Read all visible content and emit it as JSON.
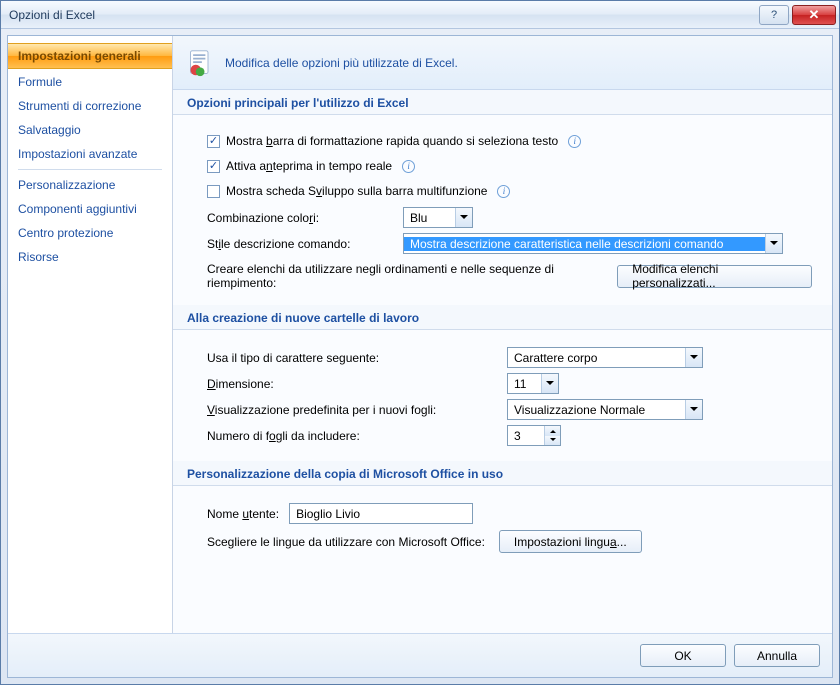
{
  "window": {
    "title": "Opzioni di Excel"
  },
  "sidebar": {
    "items": [
      "Impostazioni generali",
      "Formule",
      "Strumenti di correzione",
      "Salvataggio",
      "Impostazioni avanzate",
      "Personalizzazione",
      "Componenti aggiuntivi",
      "Centro protezione",
      "Risorse"
    ],
    "active_index": 0
  },
  "banner": {
    "text": "Modifica delle opzioni più utilizzate di Excel."
  },
  "section1": {
    "title": "Opzioni principali per l'utilizzo di Excel",
    "chk1_checked": true,
    "chk1_label_pre": "Mostra ",
    "chk1_label_u": "b",
    "chk1_label_post": "arra di formattazione rapida quando si seleziona testo",
    "chk2_checked": true,
    "chk2_label_pre": "Attiva a",
    "chk2_label_u": "n",
    "chk2_label_post": "teprima in tempo reale",
    "chk3_checked": false,
    "chk3_label_pre": "Mostra scheda S",
    "chk3_label_u": "v",
    "chk3_label_post": "iluppo sulla barra multifunzione",
    "color_label_pre": "Combinazione colo",
    "color_label_u": "r",
    "color_label_post": "i:",
    "color_value": "Blu",
    "tip_label_pre": "St",
    "tip_label_u": "i",
    "tip_label_post": "le descrizione comando:",
    "tip_value": "Mostra descrizione caratteristica nelle descrizioni comando",
    "lists_label": "Creare elenchi da utilizzare negli ordinamenti e nelle sequenze di riempimento:",
    "lists_button": "Modifica elenchi personalizzati..."
  },
  "section2": {
    "title": "Alla creazione di nuove cartelle di lavoro",
    "font_label": "Usa il tipo di carattere seguente:",
    "font_value": "Carattere corpo",
    "size_label_u": "D",
    "size_label_post": "imensione:",
    "size_value": "11",
    "view_label_u": "V",
    "view_label_post": "isualizzazione predefinita per i nuovi fogli:",
    "view_value": "Visualizzazione Normale",
    "sheets_label_pre": "Numero di f",
    "sheets_label_u": "o",
    "sheets_label_post": "gli da includere:",
    "sheets_value": "3"
  },
  "section3": {
    "title": "Personalizzazione della copia di Microsoft Office in uso",
    "user_label_pre": "Nome ",
    "user_label_u": "u",
    "user_label_post": "tente:",
    "user_value": "Bioglio Livio",
    "lang_label": "Scegliere le lingue da utilizzare con Microsoft Office:",
    "lang_button_pre": "Impostazioni lingu",
    "lang_button_u": "a",
    "lang_button_post": "..."
  },
  "footer": {
    "ok": "OK",
    "cancel": "Annulla"
  }
}
